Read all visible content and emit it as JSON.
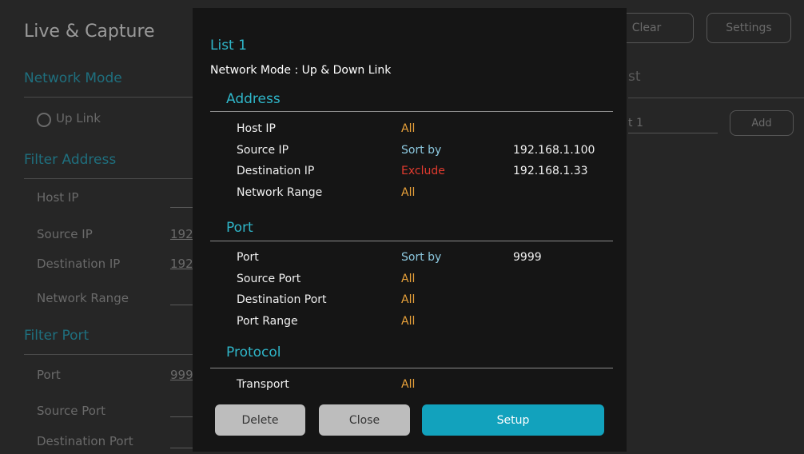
{
  "background": {
    "title": "Live & Capture",
    "sections": {
      "network_mode": "Network Mode",
      "filter_address": "Filter Address",
      "filter_port": "Filter Port"
    },
    "radio_label": "Up Link",
    "address_rows": {
      "host_ip": "Host IP",
      "source_ip": "Source IP",
      "source_ip_value": "192",
      "destination_ip": "Destination IP",
      "destination_ip_value": "192",
      "network_range": "Network Range"
    },
    "port_rows": {
      "port": "Port",
      "port_value": "999",
      "source_port": "Source Port",
      "destination_port": "Destination Port"
    },
    "top_buttons": {
      "clear": "Clear",
      "settings": "Settings"
    },
    "right_panel": {
      "title_fragment": "st",
      "field_value": "t 1",
      "add": "Add"
    }
  },
  "modal": {
    "title": "List 1",
    "network_mode": "Network Mode : Up & Down Link",
    "address": {
      "heading": "Address",
      "rows": [
        {
          "label": "Host IP",
          "status": "All",
          "status_kind": "all",
          "value": ""
        },
        {
          "label": "Source IP",
          "status": "Sort by",
          "status_kind": "sort",
          "value": "192.168.1.100"
        },
        {
          "label": "Destination IP",
          "status": "Exclude",
          "status_kind": "exclude",
          "value": "192.168.1.33"
        },
        {
          "label": "Network Range",
          "status": "All",
          "status_kind": "all",
          "value": ""
        }
      ]
    },
    "port": {
      "heading": "Port",
      "rows": [
        {
          "label": "Port",
          "status": "Sort by",
          "status_kind": "sort",
          "value": "9999"
        },
        {
          "label": "Source Port",
          "status": "All",
          "status_kind": "all",
          "value": ""
        },
        {
          "label": "Destination Port",
          "status": "All",
          "status_kind": "all",
          "value": ""
        },
        {
          "label": "Port Range",
          "status": "All",
          "status_kind": "all",
          "value": ""
        }
      ]
    },
    "protocol": {
      "heading": "Protocol",
      "rows": [
        {
          "label": "Transport",
          "status": "All",
          "status_kind": "all",
          "value": ""
        }
      ]
    },
    "buttons": {
      "delete": "Delete",
      "close": "Close",
      "setup": "Setup"
    }
  },
  "colors": {
    "accent": "#2fb6c9",
    "all": "#e8a13a",
    "sort": "#8cc8df",
    "exclude": "#e23b2f",
    "setup_button": "#12a2bd"
  }
}
